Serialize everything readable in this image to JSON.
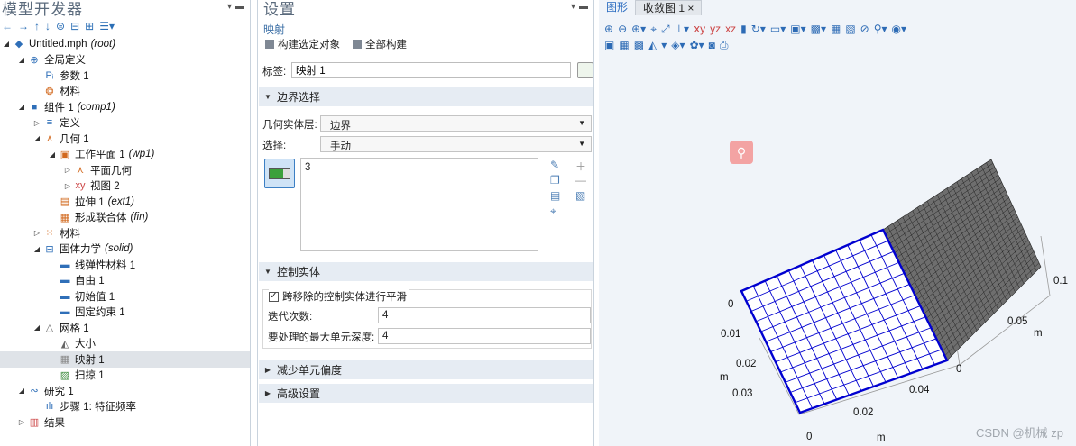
{
  "left": {
    "title": "模型开发器",
    "tree": [
      {
        "indent": 0,
        "arrow": "◢",
        "icon": "◆",
        "iconColor": "#2f6fb8",
        "label": "Untitled.mph",
        "tag": "(root)"
      },
      {
        "indent": 1,
        "arrow": "◢",
        "icon": "⊕",
        "iconColor": "#2f6fb8",
        "label": "全局定义",
        "tag": ""
      },
      {
        "indent": 2,
        "arrow": "",
        "icon": "Pᵢ",
        "iconColor": "#2f6fb8",
        "label": "参数 1",
        "tag": ""
      },
      {
        "indent": 2,
        "arrow": "",
        "icon": "❂",
        "iconColor": "#d2691e",
        "label": "材料",
        "tag": ""
      },
      {
        "indent": 1,
        "arrow": "◢",
        "icon": "■",
        "iconColor": "#2f6fb8",
        "label": "组件 1",
        "tag": "(comp1)"
      },
      {
        "indent": 2,
        "arrow": "▷",
        "icon": "≡",
        "iconColor": "#2f6fb8",
        "label": "定义",
        "tag": ""
      },
      {
        "indent": 2,
        "arrow": "◢",
        "icon": "⋏",
        "iconColor": "#d2691e",
        "label": "几何 1",
        "tag": ""
      },
      {
        "indent": 3,
        "arrow": "◢",
        "icon": "▣",
        "iconColor": "#d2691e",
        "label": "工作平面 1",
        "tag": "(wp1)"
      },
      {
        "indent": 4,
        "arrow": "▷",
        "icon": "⋏",
        "iconColor": "#d2691e",
        "label": "平面几何",
        "tag": ""
      },
      {
        "indent": 4,
        "arrow": "▷",
        "icon": "xy",
        "iconColor": "#c44",
        "label": "视图 2",
        "tag": ""
      },
      {
        "indent": 3,
        "arrow": "",
        "icon": "▤",
        "iconColor": "#d2691e",
        "label": "拉伸 1",
        "tag": "(ext1)"
      },
      {
        "indent": 3,
        "arrow": "",
        "icon": "▦",
        "iconColor": "#d2691e",
        "label": "形成联合体",
        "tag": "(fin)"
      },
      {
        "indent": 2,
        "arrow": "▷",
        "icon": "⁙",
        "iconColor": "#d2691e",
        "label": "材料",
        "tag": ""
      },
      {
        "indent": 2,
        "arrow": "◢",
        "icon": "⊟",
        "iconColor": "#2f6fb8",
        "label": "固体力学",
        "tag": "(solid)"
      },
      {
        "indent": 3,
        "arrow": "",
        "icon": "▬",
        "iconColor": "#2f6fb8",
        "label": "线弹性材料 1",
        "tag": ""
      },
      {
        "indent": 3,
        "arrow": "",
        "icon": "▬",
        "iconColor": "#2f6fb8",
        "label": "自由 1",
        "tag": ""
      },
      {
        "indent": 3,
        "arrow": "",
        "icon": "▬",
        "iconColor": "#2f6fb8",
        "label": "初始值 1",
        "tag": ""
      },
      {
        "indent": 3,
        "arrow": "",
        "icon": "▬",
        "iconColor": "#2f6fb8",
        "label": "固定约束 1",
        "tag": ""
      },
      {
        "indent": 2,
        "arrow": "◢",
        "icon": "△",
        "iconColor": "#666",
        "label": "网格 1",
        "tag": ""
      },
      {
        "indent": 3,
        "arrow": "",
        "icon": "◭",
        "iconColor": "#666",
        "label": "大小",
        "tag": ""
      },
      {
        "indent": 3,
        "arrow": "",
        "icon": "▦",
        "iconColor": "#888",
        "label": "映射 1",
        "tag": "",
        "selected": true
      },
      {
        "indent": 3,
        "arrow": "",
        "icon": "▨",
        "iconColor": "#3a8a3a",
        "label": "扫掠 1",
        "tag": ""
      },
      {
        "indent": 1,
        "arrow": "◢",
        "icon": "∾",
        "iconColor": "#2f6fb8",
        "label": "研究 1",
        "tag": ""
      },
      {
        "indent": 2,
        "arrow": "",
        "icon": "ılı",
        "iconColor": "#2f6fb8",
        "label": "步骤 1: 特征频率",
        "tag": ""
      },
      {
        "indent": 1,
        "arrow": "▷",
        "icon": "▥",
        "iconColor": "#c44",
        "label": "结果",
        "tag": ""
      }
    ]
  },
  "mid": {
    "title": "设置",
    "subtitle": "映射",
    "build_selected": "构建选定对象",
    "build_all": "全部构建",
    "label_key": "标签:",
    "label_value": "映射 1",
    "sec_boundary": "边界选择",
    "geom_level_key": "几何实体层:",
    "geom_level_val": "边界",
    "selection_key": "选择:",
    "selection_val": "手动",
    "list_value": "3",
    "sec_control": "控制实体",
    "smooth_label": "跨移除的控制实体进行平滑",
    "iter_key": "迭代次数:",
    "iter_val": "4",
    "depth_key": "要处理的最大单元深度:",
    "depth_val": "4",
    "sec_reduce": "减少单元偏度",
    "sec_advanced": "高级设置"
  },
  "right": {
    "tab_graphics": "图形",
    "tab_convergence": "收敛图 1",
    "tab_close": "×",
    "axis_labels": {
      "z0": "0",
      "z1": "0.01",
      "z2": "0.02",
      "z3": "0.03",
      "zunit": "m",
      "x0": "0",
      "x1": "0.02",
      "x2": "0.04",
      "xunit": "m",
      "y0": "0",
      "y1": "0.05",
      "y2": "0.1",
      "yunit": "m"
    },
    "watermark": "CSDN @机械 zp"
  },
  "colors": {
    "accent": "#2f6fb8",
    "mesh_blue": "#0000d0",
    "dark_face": "#6e6e6e"
  }
}
